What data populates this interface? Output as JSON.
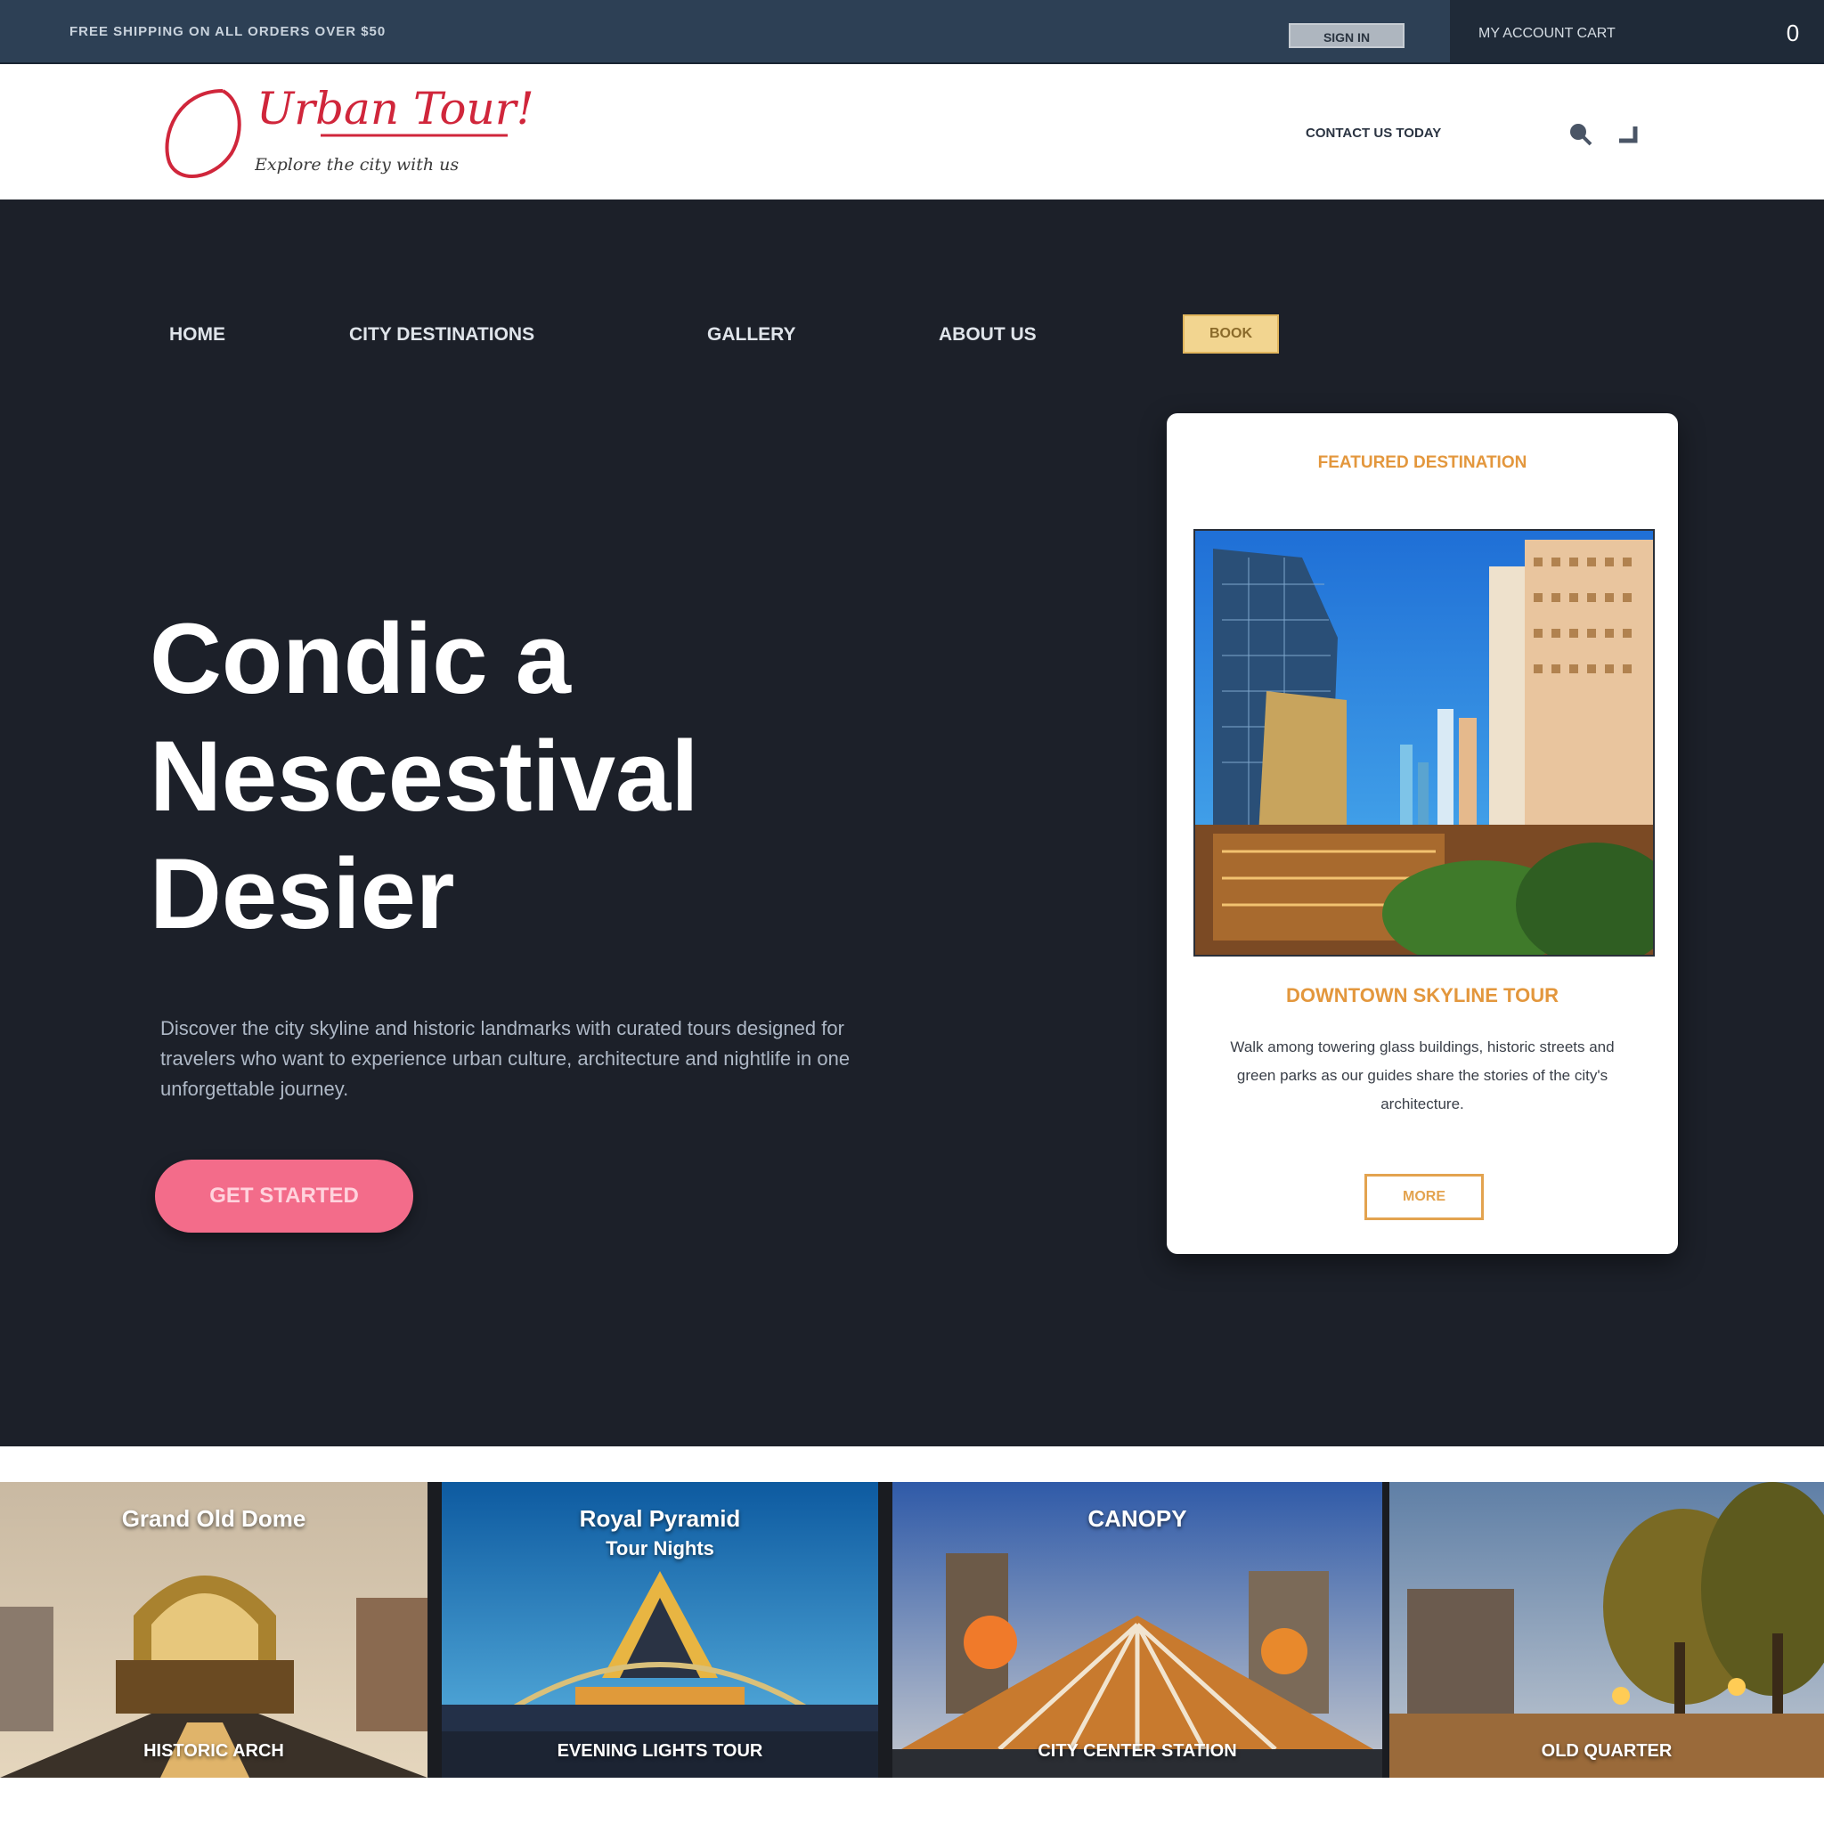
{
  "topbar": {
    "left_text": "FREE SHIPPING ON ALL ORDERS OVER $50",
    "button_label": "SIGN IN",
    "account_text": "MY ACCOUNT  CART",
    "cart_count": "0"
  },
  "header": {
    "logo_script": "Urban Tour!",
    "logo_tagline": "Explore the city with us",
    "link_text": "CONTACT US TODAY"
  },
  "nav": {
    "items": [
      "HOME",
      "CITY DESTINATIONS",
      "GALLERY",
      "ABOUT US"
    ],
    "cta": "BOOK"
  },
  "hero": {
    "headline": [
      "Condic a",
      "Nescestival",
      "Desier"
    ],
    "body": "Discover the city skyline and historic landmarks with curated tours designed for travelers who want to experience urban culture, architecture and nightlife in one unforgettable journey.",
    "cta": "GET STARTED"
  },
  "card": {
    "kicker": "FEATURED DESTINATION",
    "title": "DOWNTOWN SKYLINE TOUR",
    "text": "Walk among towering glass buildings, historic streets and green parks as our guides share the stories of the city's architecture.",
    "button": "MORE"
  },
  "gallery": {
    "tiles": [
      {
        "top": "Grand Old Dome",
        "sub": "",
        "bottom": "HISTORIC ARCH"
      },
      {
        "top": "Royal Pyramid",
        "sub": "Tour Nights",
        "bottom": "EVENING LIGHTS TOUR"
      },
      {
        "top": "CANOPY",
        "sub": "",
        "bottom": "CITY CENTER STATION"
      },
      {
        "top": "",
        "sub": "",
        "bottom": "OLD QUARTER"
      }
    ]
  },
  "colors": {
    "topbar": "#2d4055",
    "hero_bg": "#1c2029",
    "accent_pink": "#f36c8a",
    "accent_orange": "#e3973d",
    "logo_red": "#d0263b"
  }
}
